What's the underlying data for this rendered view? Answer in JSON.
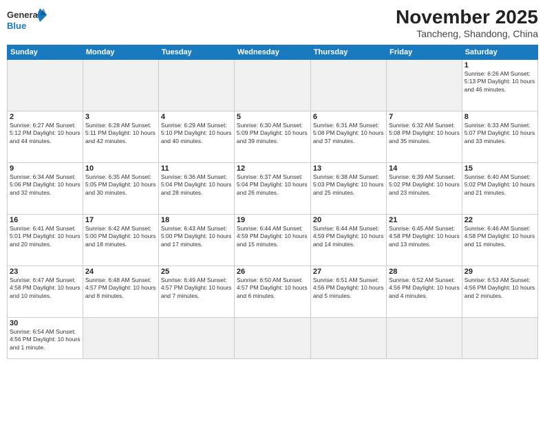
{
  "logo": {
    "general": "General",
    "blue": "Blue"
  },
  "title": {
    "month_year": "November 2025",
    "location": "Tancheng, Shandong, China"
  },
  "days_of_week": [
    "Sunday",
    "Monday",
    "Tuesday",
    "Wednesday",
    "Thursday",
    "Friday",
    "Saturday"
  ],
  "weeks": [
    [
      {
        "day": "",
        "info": ""
      },
      {
        "day": "",
        "info": ""
      },
      {
        "day": "",
        "info": ""
      },
      {
        "day": "",
        "info": ""
      },
      {
        "day": "",
        "info": ""
      },
      {
        "day": "",
        "info": ""
      },
      {
        "day": "1",
        "info": "Sunrise: 6:26 AM\nSunset: 5:13 PM\nDaylight: 10 hours and 46 minutes."
      }
    ],
    [
      {
        "day": "2",
        "info": "Sunrise: 6:27 AM\nSunset: 5:12 PM\nDaylight: 10 hours and 44 minutes."
      },
      {
        "day": "3",
        "info": "Sunrise: 6:28 AM\nSunset: 5:11 PM\nDaylight: 10 hours and 42 minutes."
      },
      {
        "day": "4",
        "info": "Sunrise: 6:29 AM\nSunset: 5:10 PM\nDaylight: 10 hours and 40 minutes."
      },
      {
        "day": "5",
        "info": "Sunrise: 6:30 AM\nSunset: 5:09 PM\nDaylight: 10 hours and 39 minutes."
      },
      {
        "day": "6",
        "info": "Sunrise: 6:31 AM\nSunset: 5:08 PM\nDaylight: 10 hours and 37 minutes."
      },
      {
        "day": "7",
        "info": "Sunrise: 6:32 AM\nSunset: 5:08 PM\nDaylight: 10 hours and 35 minutes."
      },
      {
        "day": "8",
        "info": "Sunrise: 6:33 AM\nSunset: 5:07 PM\nDaylight: 10 hours and 33 minutes."
      }
    ],
    [
      {
        "day": "9",
        "info": "Sunrise: 6:34 AM\nSunset: 5:06 PM\nDaylight: 10 hours and 32 minutes."
      },
      {
        "day": "10",
        "info": "Sunrise: 6:35 AM\nSunset: 5:05 PM\nDaylight: 10 hours and 30 minutes."
      },
      {
        "day": "11",
        "info": "Sunrise: 6:36 AM\nSunset: 5:04 PM\nDaylight: 10 hours and 28 minutes."
      },
      {
        "day": "12",
        "info": "Sunrise: 6:37 AM\nSunset: 5:04 PM\nDaylight: 10 hours and 26 minutes."
      },
      {
        "day": "13",
        "info": "Sunrise: 6:38 AM\nSunset: 5:03 PM\nDaylight: 10 hours and 25 minutes."
      },
      {
        "day": "14",
        "info": "Sunrise: 6:39 AM\nSunset: 5:02 PM\nDaylight: 10 hours and 23 minutes."
      },
      {
        "day": "15",
        "info": "Sunrise: 6:40 AM\nSunset: 5:02 PM\nDaylight: 10 hours and 21 minutes."
      }
    ],
    [
      {
        "day": "16",
        "info": "Sunrise: 6:41 AM\nSunset: 5:01 PM\nDaylight: 10 hours and 20 minutes."
      },
      {
        "day": "17",
        "info": "Sunrise: 6:42 AM\nSunset: 5:00 PM\nDaylight: 10 hours and 18 minutes."
      },
      {
        "day": "18",
        "info": "Sunrise: 6:43 AM\nSunset: 5:00 PM\nDaylight: 10 hours and 17 minutes."
      },
      {
        "day": "19",
        "info": "Sunrise: 6:44 AM\nSunset: 4:59 PM\nDaylight: 10 hours and 15 minutes."
      },
      {
        "day": "20",
        "info": "Sunrise: 6:44 AM\nSunset: 4:59 PM\nDaylight: 10 hours and 14 minutes."
      },
      {
        "day": "21",
        "info": "Sunrise: 6:45 AM\nSunset: 4:58 PM\nDaylight: 10 hours and 13 minutes."
      },
      {
        "day": "22",
        "info": "Sunrise: 6:46 AM\nSunset: 4:58 PM\nDaylight: 10 hours and 11 minutes."
      }
    ],
    [
      {
        "day": "23",
        "info": "Sunrise: 6:47 AM\nSunset: 4:58 PM\nDaylight: 10 hours and 10 minutes."
      },
      {
        "day": "24",
        "info": "Sunrise: 6:48 AM\nSunset: 4:57 PM\nDaylight: 10 hours and 8 minutes."
      },
      {
        "day": "25",
        "info": "Sunrise: 6:49 AM\nSunset: 4:57 PM\nDaylight: 10 hours and 7 minutes."
      },
      {
        "day": "26",
        "info": "Sunrise: 6:50 AM\nSunset: 4:57 PM\nDaylight: 10 hours and 6 minutes."
      },
      {
        "day": "27",
        "info": "Sunrise: 6:51 AM\nSunset: 4:56 PM\nDaylight: 10 hours and 5 minutes."
      },
      {
        "day": "28",
        "info": "Sunrise: 6:52 AM\nSunset: 4:56 PM\nDaylight: 10 hours and 4 minutes."
      },
      {
        "day": "29",
        "info": "Sunrise: 6:53 AM\nSunset: 4:56 PM\nDaylight: 10 hours and 2 minutes."
      }
    ],
    [
      {
        "day": "30",
        "info": "Sunrise: 6:54 AM\nSunset: 4:56 PM\nDaylight: 10 hours and 1 minute."
      },
      {
        "day": "",
        "info": ""
      },
      {
        "day": "",
        "info": ""
      },
      {
        "day": "",
        "info": ""
      },
      {
        "day": "",
        "info": ""
      },
      {
        "day": "",
        "info": ""
      },
      {
        "day": "",
        "info": ""
      }
    ]
  ]
}
